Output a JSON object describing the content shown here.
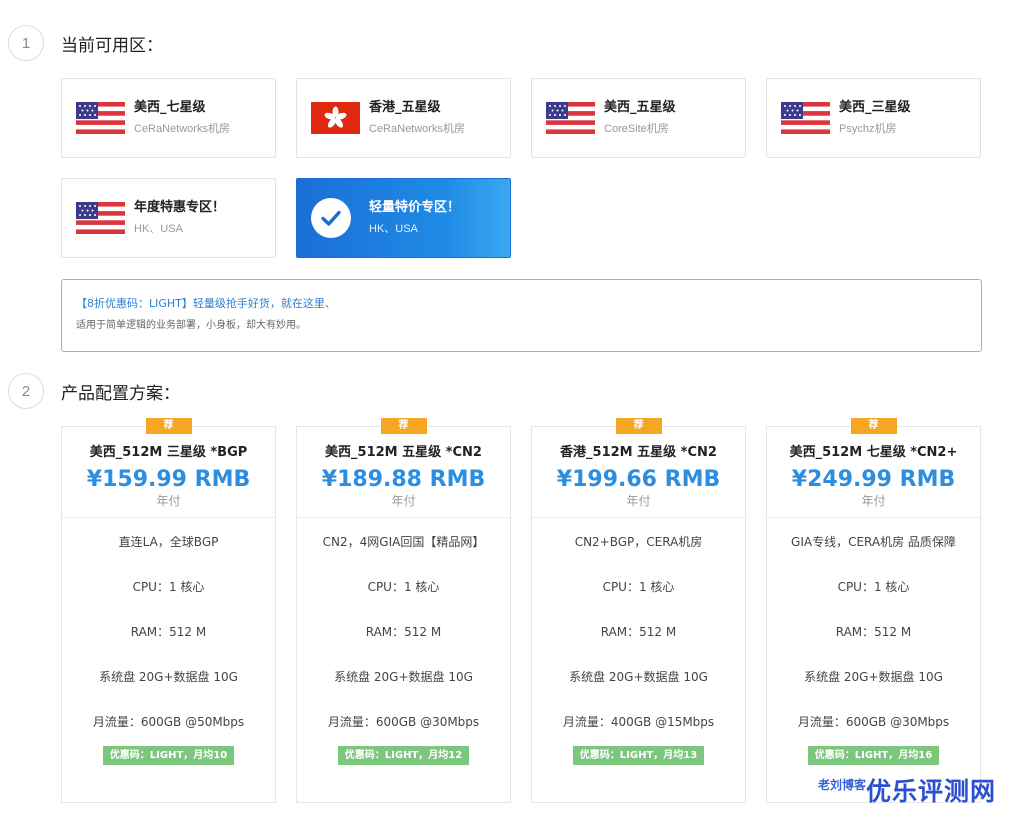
{
  "steps": [
    {
      "num": "1",
      "title": "当前可用区："
    },
    {
      "num": "2",
      "title": "产品配置方案："
    }
  ],
  "zones": [
    {
      "name": "美西_七星级",
      "sub": "CeRaNetworks机房",
      "flag": "usa-flag"
    },
    {
      "name": "香港_五星级",
      "sub": "CeRaNetworks机房",
      "flag": "hk-flag"
    },
    {
      "name": "美西_五星级",
      "sub": "CoreSite机房",
      "flag": "usa-flag"
    },
    {
      "name": "美西_三星级",
      "sub": "Psychz机房",
      "flag": "usa-flag"
    },
    {
      "name": "年度特惠专区！",
      "sub": "HK、USA",
      "flag": "usa-flag"
    },
    {
      "name": "轻量特价专区！",
      "sub": "HK、USA",
      "flag": "check-icon",
      "selected": true
    }
  ],
  "notice": {
    "line1": "【8折优惠码：LIGHT】轻量级抢手好货，就在这里、",
    "line2": "适用于简单逻辑的业务部署，小身板，却大有妙用。"
  },
  "badge_label": "荐",
  "plans": [
    {
      "title": "美西_512M 三星级 *BGP",
      "price": "¥159.99 RMB",
      "cycle": "年付",
      "features": [
        "直连LA，全球BGP",
        "CPU：1 核心",
        "RAM：512 M",
        "系统盘 20G+数据盘 10G",
        "月流量：600GB @50Mbps"
      ],
      "promo": "优惠码：LIGHT，月均10"
    },
    {
      "title": "美西_512M 五星级 *CN2",
      "price": "¥189.88 RMB",
      "cycle": "年付",
      "features": [
        "CN2，4网GIA回国【精品网】",
        "CPU：1 核心",
        "RAM：512 M",
        "系统盘 20G+数据盘 10G",
        "月流量：600GB @30Mbps"
      ],
      "promo": "优惠码：LIGHT，月均12"
    },
    {
      "title": "香港_512M 五星级 *CN2",
      "price": "¥199.66 RMB",
      "cycle": "年付",
      "features": [
        "CN2+BGP，CERA机房",
        "CPU：1 核心",
        "RAM：512 M",
        "系统盘 20G+数据盘 10G",
        "月流量：400GB @15Mbps"
      ],
      "promo": "优惠码：LIGHT，月均13"
    },
    {
      "title": "美西_512M 七星级 *CN2+",
      "price": "¥249.99 RMB",
      "cycle": "年付",
      "features": [
        "GIA专线，CERA机房 品质保障",
        "CPU：1 核心",
        "RAM：512 M",
        "系统盘 20G+数据盘 10G",
        "月流量：600GB @30Mbps"
      ],
      "promo": "优惠码：LIGHT，月均16"
    }
  ],
  "watermark": {
    "small": "老刘博客",
    "big": "优乐评测网"
  },
  "colors": {
    "accent": "#2b8ee0",
    "badge": "#f5a623",
    "promo": "#7dc67d",
    "active_zone": "#1a6fd6"
  }
}
